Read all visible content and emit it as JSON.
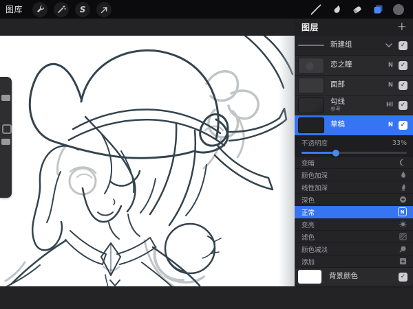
{
  "toolbar": {
    "gallery_label": "图库",
    "selection_label": "S",
    "left_icons": [
      "wrench-actions",
      "magic-wand-adjustments",
      "selection-s",
      "transform-arrow"
    ],
    "right_icons": [
      "brush",
      "smudge-finger",
      "eraser",
      "layers-active",
      "color-circle"
    ],
    "layers_icon_color": "#3f7cf6",
    "current_color": "#626267"
  },
  "icons": {
    "check": "✓"
  },
  "layers_panel": {
    "title": "图层",
    "add_button": "+",
    "group_row": {
      "name": "新建组",
      "checked": true
    },
    "layers": [
      {
        "name": "恋之瞳",
        "badge": "N",
        "checked": true,
        "selected": false
      },
      {
        "name": "面部",
        "badge": "N",
        "checked": true,
        "selected": false
      },
      {
        "name": "勾线",
        "subtitle": "参考",
        "badge": "Hl",
        "checked": true,
        "selected": false
      },
      {
        "name": "草稿",
        "badge": "N",
        "checked": true,
        "selected": true
      }
    ],
    "opacity": {
      "label": "不透明度",
      "value": "33%",
      "percent": 33
    },
    "blend_modes": [
      {
        "name": "变暗",
        "icon": "darken-moon"
      },
      {
        "name": "颜色加深",
        "icon": "color-burn-drop"
      },
      {
        "name": "线性加深",
        "icon": "linear-burn-flame"
      },
      {
        "name": "深色",
        "icon": "darker-color-circle-plus"
      },
      {
        "name": "正常",
        "icon": "normal-n-badge",
        "badge": "N",
        "selected": true
      },
      {
        "name": "变亮",
        "icon": "lighten-sun"
      },
      {
        "name": "滤色",
        "icon": "screen-hatch"
      },
      {
        "name": "颜色减淡",
        "icon": "color-dodge-lens"
      },
      {
        "name": "添加",
        "icon": "add-plus-square"
      }
    ],
    "background_row": {
      "label": "背景颜色",
      "swatch": "#ffffff",
      "checked": true
    }
  },
  "colors": {
    "toolbar_bg": "#0b0b0d",
    "workspace_bg": "#232326",
    "panel_bg": "#202023",
    "row_bg": "#2a2a2d",
    "selected_blue": "#3574f2",
    "canvas": "#ffffff",
    "ink": "#34444f",
    "sketch_gray": "#c2c5c8"
  }
}
